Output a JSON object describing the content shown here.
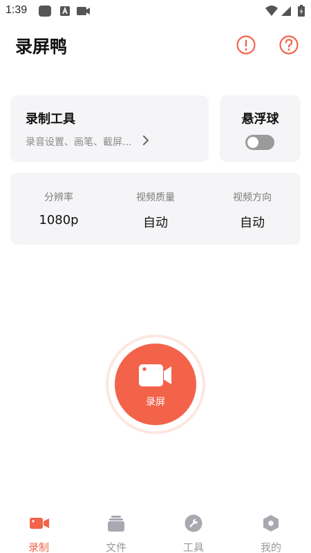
{
  "status_bar": {
    "time": "1:39"
  },
  "header": {
    "title": "录屏鸭",
    "info_icon": "exclamation-circle-icon",
    "help_icon": "question-circle-icon"
  },
  "record_tools": {
    "title": "录制工具",
    "subtitle": "录音设置、画笔、截屏..."
  },
  "floating_ball": {
    "title": "悬浮球",
    "enabled": false
  },
  "settings": [
    {
      "label": "分辨率",
      "value": "1080p"
    },
    {
      "label": "视频质量",
      "value": "自动"
    },
    {
      "label": "视频方向",
      "value": "自动"
    }
  ],
  "record_button": {
    "label": "录屏",
    "icon": "video-camera-icon"
  },
  "bottom_nav": [
    {
      "label": "录制",
      "icon": "video-camera-icon",
      "active": true
    },
    {
      "label": "文件",
      "icon": "folder-stack-icon",
      "active": false
    },
    {
      "label": "工具",
      "icon": "wrench-icon",
      "active": false
    },
    {
      "label": "我的",
      "icon": "hexagon-user-icon",
      "active": false
    }
  ],
  "colors": {
    "accent": "#f2634a",
    "card_bg": "#f5f5f7",
    "inactive": "#9a9a9a"
  }
}
